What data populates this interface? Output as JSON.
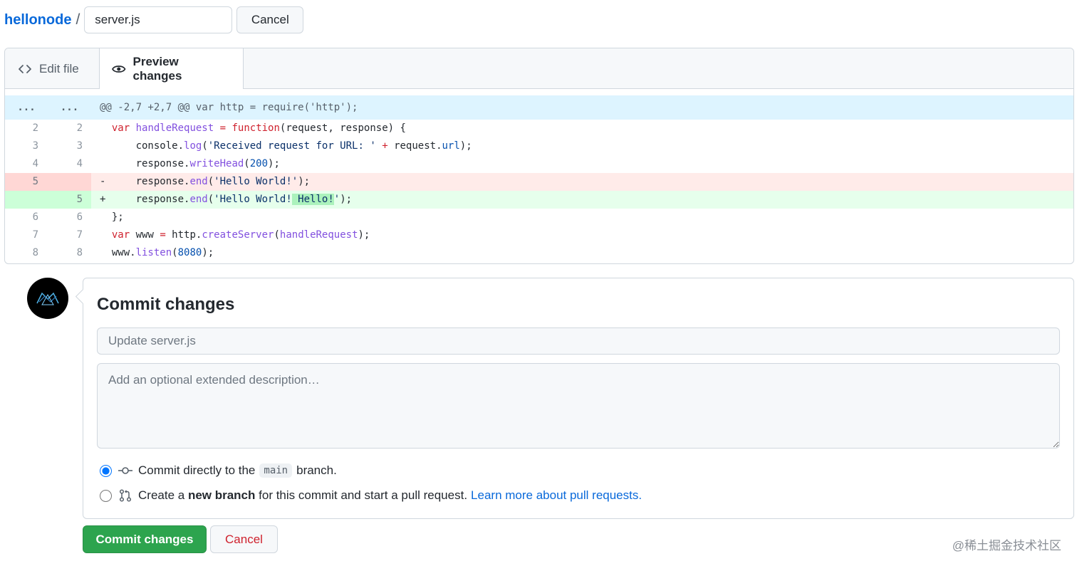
{
  "breadcrumb": {
    "repo": "hellonode",
    "separator": "/",
    "filename_value": "server.js",
    "cancel_label": "Cancel"
  },
  "tabs": {
    "edit_label": "Edit file",
    "preview_label": "Preview changes",
    "active": "preview"
  },
  "diff": {
    "hunk_left": "...",
    "hunk_right": "...",
    "hunk_header": "@@ -2,7 +2,7 @@ var http = require('http');",
    "lines": [
      {
        "type": "context",
        "old": "2",
        "new": "2",
        "text": "  var handleRequest = function(request, response) {"
      },
      {
        "type": "context",
        "old": "3",
        "new": "3",
        "text": "      console.log('Received request for URL: ' + request.url);"
      },
      {
        "type": "context",
        "old": "4",
        "new": "4",
        "text": "      response.writeHead(200);"
      },
      {
        "type": "deletion",
        "old": "5",
        "new": "",
        "text": "-     response.end('Hello World!');"
      },
      {
        "type": "addition",
        "old": "",
        "new": "5",
        "text": "+     response.end('Hello World! Hello!');"
      },
      {
        "type": "context",
        "old": "6",
        "new": "6",
        "text": "  };"
      },
      {
        "type": "context",
        "old": "7",
        "new": "7",
        "text": "  var www = http.createServer(handleRequest);"
      },
      {
        "type": "context",
        "old": "8",
        "new": "8",
        "text": "  www.listen(8080);"
      }
    ]
  },
  "commit": {
    "title": "Commit changes",
    "summary_placeholder": "Update server.js",
    "description_placeholder": "Add an optional extended description…",
    "option_direct_prefix": "Commit directly to the",
    "option_direct_branch": "main",
    "option_direct_suffix": "branch.",
    "option_direct_selected": true,
    "option_new_prefix": "Create a",
    "option_new_bold": "new branch",
    "option_new_suffix": "for this commit and start a pull request.",
    "option_new_link": "Learn more about pull requests.",
    "submit_label": "Commit changes",
    "cancel_label": "Cancel"
  },
  "watermark": "@稀土掘金技术社区",
  "colors": {
    "link": "#0969da",
    "commit_button": "#2da44e",
    "cancel_text": "#cf222e",
    "deletion_bg": "#ffebe9",
    "addition_bg": "#e6ffec",
    "hunk_bg": "#ddf4ff"
  }
}
